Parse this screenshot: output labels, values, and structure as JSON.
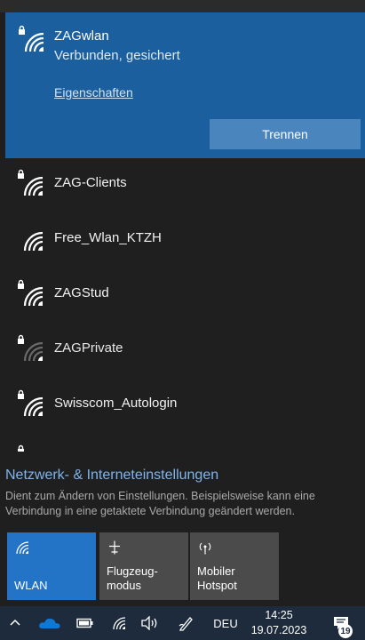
{
  "connected": {
    "name": "ZAGwlan",
    "status": "Verbunden, gesichert",
    "properties_link": "Eigenschaften",
    "disconnect_label": "Trennen"
  },
  "networks": [
    {
      "name": "ZAG-Clients",
      "secured": true,
      "signal": "full"
    },
    {
      "name": "Free_Wlan_KTZH",
      "secured": false,
      "signal": "full"
    },
    {
      "name": "ZAGStud",
      "secured": true,
      "signal": "full"
    },
    {
      "name": "ZAGPrivate",
      "secured": true,
      "signal": "weak"
    },
    {
      "name": "Swisscom_Autologin",
      "secured": true,
      "signal": "full"
    },
    {
      "name": "",
      "secured": true,
      "signal": "partial"
    }
  ],
  "settings": {
    "title": "Netzwerk- & Interneteinstellungen",
    "description": "Dient zum Ändern von Einstellungen. Beispielsweise kann eine Verbindung in eine getaktete Verbindung geändert werden."
  },
  "quick_actions": [
    {
      "label": "WLAN",
      "icon": "wifi-icon",
      "active": true
    },
    {
      "label": "Flugzeug-\nmodus",
      "icon": "airplane-icon",
      "active": false
    },
    {
      "label": "Mobiler\nHotspot",
      "icon": "hotspot-icon",
      "active": false
    }
  ],
  "taskbar": {
    "language": "DEU",
    "time": "14:25",
    "date": "19.07.2023",
    "notification_count": "19"
  },
  "colors": {
    "connected_bg": "#1b5f9e",
    "accent_tile": "#2373c6",
    "link": "#7fb4ec",
    "taskbar_bg": "#1d2b3c"
  }
}
